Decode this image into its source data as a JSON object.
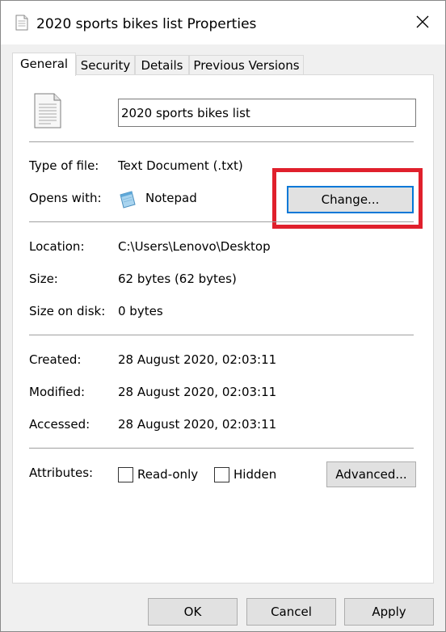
{
  "window": {
    "title": "2020 sports bikes list Properties",
    "close_icon": "close-icon"
  },
  "tabs": [
    {
      "label": "General",
      "active": true
    },
    {
      "label": "Security",
      "active": false
    },
    {
      "label": "Details",
      "active": false
    },
    {
      "label": "Previous Versions",
      "active": false
    }
  ],
  "general": {
    "file_name": "2020 sports bikes list",
    "type_label": "Type of file:",
    "type_value": "Text Document (.txt)",
    "opens_label": "Opens with:",
    "opens_value": "Notepad",
    "change_button": "Change...",
    "location_label": "Location:",
    "location_value": "C:\\Users\\Lenovo\\Desktop",
    "size_label": "Size:",
    "size_value": "62 bytes (62 bytes)",
    "size_on_disk_label": "Size on disk:",
    "size_on_disk_value": "0 bytes",
    "created_label": "Created:",
    "created_value": "28 August 2020, 02:03:11",
    "modified_label": "Modified:",
    "modified_value": "28 August 2020, 02:03:11",
    "accessed_label": "Accessed:",
    "accessed_value": "28 August 2020, 02:03:11",
    "attributes_label": "Attributes:",
    "readonly_label": "Read-only",
    "readonly_checked": false,
    "hidden_label": "Hidden",
    "hidden_checked": false,
    "advanced_button": "Advanced..."
  },
  "footer": {
    "ok_button": "OK",
    "cancel_button": "Cancel",
    "apply_button": "Apply"
  },
  "colors": {
    "highlight": "#e0202c",
    "focus": "#0078d7"
  }
}
